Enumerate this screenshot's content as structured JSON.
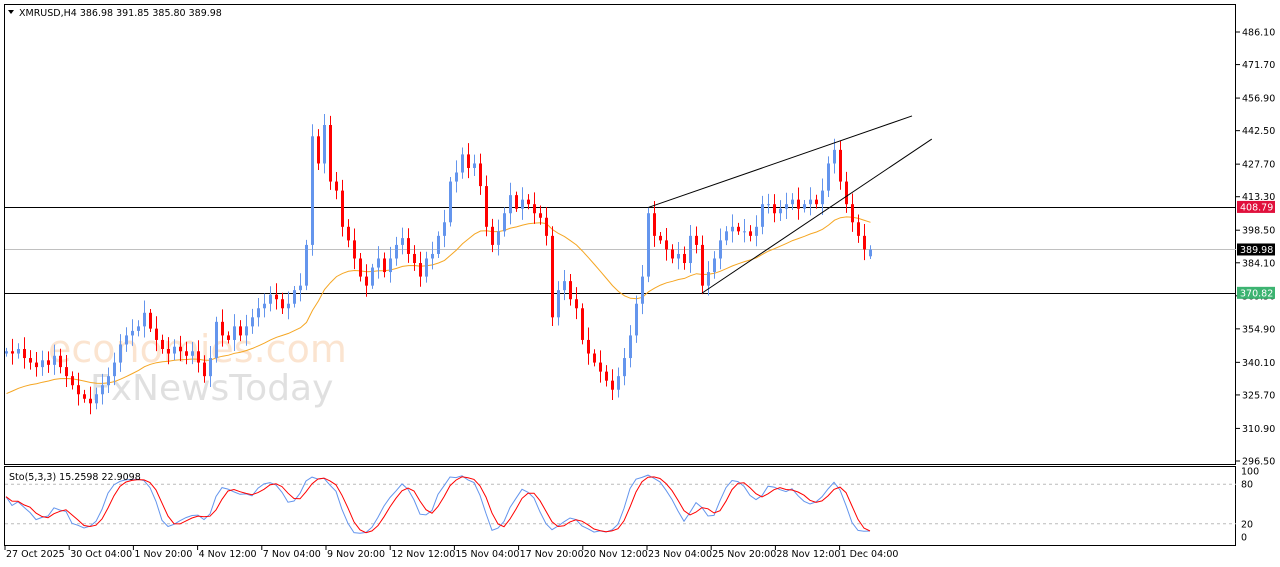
{
  "chart_data": {
    "type": "candlestick",
    "symbol": "XMRUSD",
    "timeframe": "H4",
    "header": "XMRUSD,H4  386.98 391.85 385.80 389.98",
    "last_bar": {
      "open": 386.98,
      "high": 391.85,
      "low": 385.8,
      "close": 389.98
    },
    "ylim": [
      296.5,
      486.1
    ],
    "y_ticks": [
      "486.10",
      "471.70",
      "456.90",
      "442.50",
      "427.70",
      "413.30",
      "398.50",
      "384.10",
      "369.50",
      "354.90",
      "340.10",
      "325.70",
      "310.90",
      "296.50"
    ],
    "x_ticks": [
      "27 Oct 2025",
      "30 Oct 04:00",
      "1 Nov 20:00",
      "4 Nov 12:00",
      "7 Nov 04:00",
      "9 Nov 20:00",
      "12 Nov 12:00",
      "15 Nov 04:00",
      "17 Nov 20:00",
      "20 Nov 12:00",
      "23 Nov 04:00",
      "25 Nov 20:00",
      "28 Nov 12:00",
      "1 Dec 04:00"
    ],
    "closes": [
      345,
      344,
      346,
      342,
      340,
      338,
      341,
      339,
      343,
      338,
      334,
      330,
      326,
      324,
      322,
      326,
      330,
      334,
      340,
      348,
      352,
      354,
      356,
      362,
      355,
      350,
      346,
      344,
      347,
      345,
      343,
      345,
      340,
      334,
      342,
      358,
      352,
      350,
      356,
      352,
      356,
      360,
      364,
      366,
      370,
      368,
      364,
      366,
      372,
      374,
      392,
      440,
      428,
      445,
      420,
      416,
      400,
      394,
      386,
      378,
      374,
      382,
      386,
      380,
      386,
      392,
      395,
      388,
      384,
      378,
      386,
      388,
      396,
      402,
      420,
      424,
      432,
      426,
      428,
      418,
      400,
      392,
      398,
      406,
      414,
      408,
      412,
      410,
      406,
      404,
      396,
      360,
      372,
      376,
      368,
      364,
      350,
      344,
      340,
      336,
      332,
      328,
      334,
      342,
      352,
      366,
      378,
      406,
      396,
      394,
      390,
      386,
      388,
      384,
      396,
      392,
      374,
      380,
      386,
      394,
      398,
      400,
      398,
      398,
      396,
      400,
      410,
      410,
      406,
      408,
      410,
      412,
      408,
      410,
      412,
      410,
      416,
      428,
      434,
      420,
      410,
      402,
      396,
      390,
      389.98
    ],
    "levels": [
      {
        "price": 408.79,
        "label": "408.79",
        "line": "#000000",
        "bg": "#e0103c"
      },
      {
        "price": 389.98,
        "label": "389.98",
        "line": "#c0c0c0",
        "bg": "#000000"
      },
      {
        "price": 370.82,
        "label": "370.82",
        "line": "#000000",
        "bg": "#3cb371"
      }
    ],
    "trendlines": [
      {
        "from": [
          107,
          408.5
        ],
        "to": [
          151,
          449.0
        ]
      },
      {
        "from": [
          116,
          370.7
        ],
        "to": [
          154.3,
          438.8
        ]
      }
    ],
    "moving_average": {
      "type": "EMA",
      "period": 30,
      "color": "#f5a623"
    },
    "colors": {
      "bull": "#6495ed",
      "bear": "#ff0000"
    },
    "stochastic": {
      "label": "Sto(5,3,3) 15.2598 22.9098",
      "params": [
        5,
        3,
        3
      ],
      "levels": [
        "100",
        "80",
        "20",
        "0"
      ],
      "k_color": "#6495ed",
      "d_color": "#ff0000"
    },
    "watermark": [
      "economies.com",
      "FxNewsToday"
    ]
  }
}
